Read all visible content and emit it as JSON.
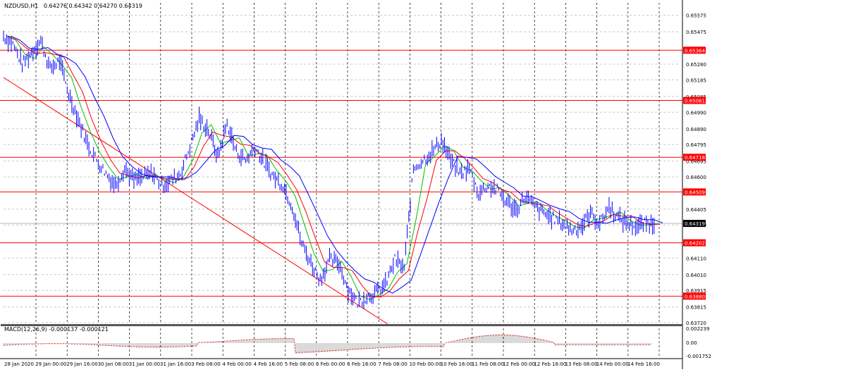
{
  "header": {
    "title": "NZDUSD,H1",
    "ohlc": "0.64276 0.64342 0.64270 0.64319"
  },
  "macd": {
    "label": "MACD(12,26,9) -0.000137 -0.000121",
    "y_ticks": [
      "0.002239",
      "0.00",
      "-0.001752"
    ]
  },
  "chart_data": {
    "type": "line",
    "title": "NZDUSD,H1",
    "y_ticks": [
      "0.65575",
      "0.65475",
      "0.65280",
      "0.65185",
      "0.65085",
      "0.64990",
      "0.64890",
      "0.64795",
      "0.64695",
      "0.64600",
      "0.64405",
      "0.64310",
      "0.64110",
      "0.64010",
      "0.63915",
      "0.63815",
      "0.63720"
    ],
    "ylim": [
      0.6372,
      0.6565
    ],
    "x_ticks": [
      "28 Jan 2020",
      "29 Jan 00:00",
      "29 Jan 16:00",
      "30 Jan 08:00",
      "31 Jan 00:00",
      "31 Jan 16:00",
      "3 Feb 08:00",
      "4 Feb 00:00",
      "4 Feb 16:00",
      "5 Feb 08:00",
      "6 Feb 00:00",
      "6 Feb 16:00",
      "7 Feb 08:00",
      "10 Feb 00:00",
      "10 Feb 16:00",
      "11 Feb 08:00",
      "12 Feb 00:00",
      "12 Feb 16:00",
      "13 Feb 08:00",
      "14 Feb 00:00",
      "14 Feb 16:00"
    ],
    "levels": [
      {
        "label": "0.65364",
        "value": 0.65364
      },
      {
        "label": "0.65061",
        "value": 0.65061
      },
      {
        "label": "0.64718",
        "value": 0.64718
      },
      {
        "label": "0.64509",
        "value": 0.64509
      },
      {
        "label": "0.64202",
        "value": 0.64202
      },
      {
        "label": "0.63880",
        "value": 0.6388
      }
    ],
    "current_price": {
      "label": "0.64319",
      "value": 0.64319
    },
    "price_series": {
      "name": "Close",
      "x": [
        0,
        6,
        12,
        18,
        24,
        30,
        36,
        42,
        48,
        54,
        60,
        66,
        72,
        78,
        84,
        90,
        96,
        102,
        108,
        114,
        120,
        126,
        132,
        138,
        144,
        150,
        156,
        162,
        168,
        174,
        180,
        186,
        192,
        198,
        204,
        210,
        216,
        222,
        228,
        234,
        240,
        246,
        252,
        258,
        264,
        270,
        276,
        282,
        288,
        294,
        300,
        306,
        312,
        318,
        324,
        330,
        336,
        342,
        348,
        354,
        360,
        366,
        372,
        378,
        384,
        390,
        396,
        402,
        408,
        414,
        420
      ],
      "values": [
        0.6545,
        0.654,
        0.6528,
        0.6535,
        0.6542,
        0.6525,
        0.653,
        0.651,
        0.6495,
        0.648,
        0.647,
        0.6462,
        0.6455,
        0.6465,
        0.6458,
        0.646,
        0.6462,
        0.6455,
        0.6458,
        0.6462,
        0.6478,
        0.6495,
        0.6488,
        0.6472,
        0.6492,
        0.6475,
        0.647,
        0.6478,
        0.6468,
        0.646,
        0.6455,
        0.6442,
        0.642,
        0.6408,
        0.6398,
        0.641,
        0.6408,
        0.6392,
        0.6384,
        0.6388,
        0.639,
        0.6395,
        0.641,
        0.6405,
        0.6465,
        0.647,
        0.6475,
        0.6482,
        0.647,
        0.6462,
        0.6465,
        0.645,
        0.6455,
        0.6452,
        0.6445,
        0.644,
        0.6448,
        0.6442,
        0.6438,
        0.6435,
        0.6432,
        0.6428,
        0.643,
        0.6438,
        0.6432,
        0.6442,
        0.6435,
        0.6432,
        0.643,
        0.6432,
        0.6432
      ]
    }
  },
  "colors": {
    "price": "#0000ff",
    "ma_fast": "#00c000",
    "ma_mid": "#ff0000",
    "ma_slow": "#0000ff",
    "level": "#ff0000",
    "grid": "#c8c8c8",
    "vline": "#000000"
  }
}
